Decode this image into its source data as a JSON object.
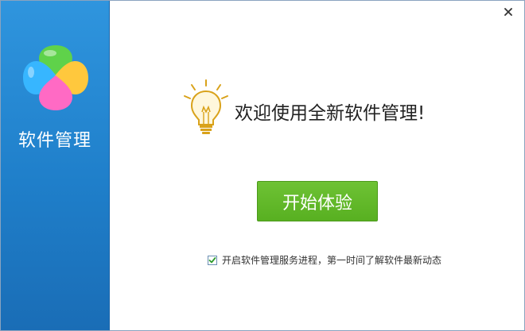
{
  "sidebar": {
    "title": "软件管理",
    "logo_icon": "four-petal-logo-icon"
  },
  "window": {
    "close_icon": "close-icon"
  },
  "main": {
    "bulb_icon": "light-bulb-icon",
    "welcome_text": "欢迎使用全新软件管理!",
    "start_button_label": "开始体验",
    "option": {
      "checked": true,
      "label": "开启软件管理服务进程，第一时间了解软件最新动态"
    }
  },
  "colors": {
    "sidebar_blue": "#1f7fca",
    "button_green": "#5db626",
    "petal_green": "#5fd24a",
    "petal_yellow": "#ffc83d",
    "petal_blue": "#37b6ff",
    "petal_pink": "#ff6ac4",
    "bulb_gold": "#d9a21a"
  }
}
